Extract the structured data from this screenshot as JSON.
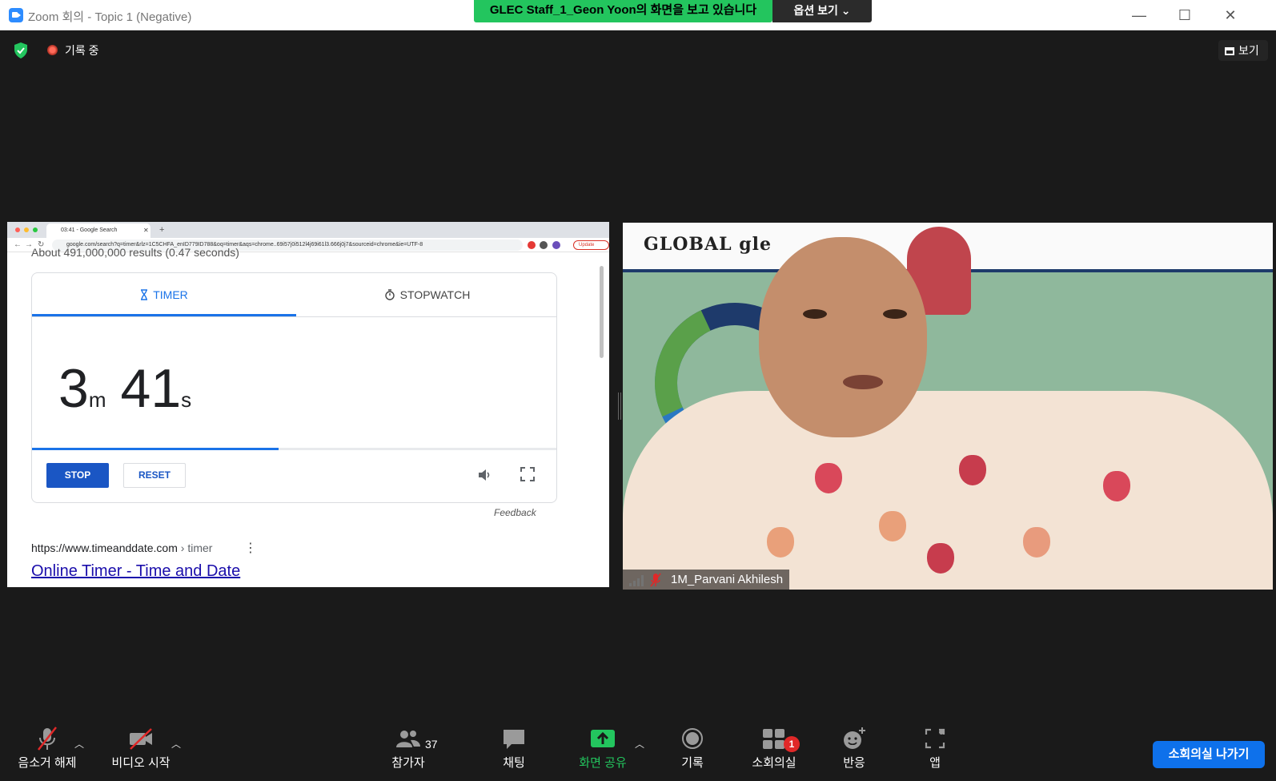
{
  "window": {
    "title": "Zoom 회의 - Topic 1 (Negative)",
    "controls": {
      "minimize": "—",
      "maximize": "☐",
      "close": "✕"
    }
  },
  "share_banner": {
    "text": "GLEC Staff_1_Geon Yoon의 화면을 보고 있습니다",
    "view_options": "옵션 보기 ⌄"
  },
  "meeting": {
    "recording_label": "기록 중",
    "view_button": "보기"
  },
  "shared_screen": {
    "browser_tab_title": "03:41 - Google Search",
    "address": "google.com/search?q=timer&rlz=1C5CHFA_enID779ID788&oq=timer&aqs=chrome..69i57j0i512l4j69i61l3.666j0j7&sourceid=chrome&ie=UTF-8",
    "update_label": "Update",
    "results_partial": "About 491,000,000 results (0.47 seconds)",
    "timer_tab": "TIMER",
    "stopwatch_tab": "STOPWATCH",
    "time_minutes": "3",
    "minutes_unit": "m",
    "time_seconds": "41",
    "seconds_unit": "s",
    "progress_fraction": 0.47,
    "stop_label": "STOP",
    "reset_label": "RESET",
    "feedback": "Feedback",
    "result_url_host": "https://www.timeanddate.com",
    "result_url_path": " › timer",
    "result_title": "Online Timer - Time and Date"
  },
  "video_tile": {
    "wall_logo": "GLOBAL gle",
    "participant_name": "1M_Parvani Akhilesh"
  },
  "toolbar": {
    "unmute_label": "음소거 해제",
    "start_video_label": "비디오 시작",
    "participants_label": "참가자",
    "participants_count": "37",
    "chat_label": "채팅",
    "share_label": "화면 공유",
    "record_label": "기록",
    "breakout_label": "소회의실",
    "breakout_badge": "1",
    "reactions_label": "반응",
    "apps_label": "앱",
    "leave_breakout_label": "소회의실 나가기"
  },
  "colors": {
    "share_banner_bg": "#23c55e",
    "share_icon": "#23c55e",
    "leave_button": "#0e71eb",
    "timer_accent": "#1a73e8",
    "stop_button": "#1a56c4",
    "badge_red": "#e02828"
  },
  "icons": [
    "zoom-logo-icon",
    "security-shield-icon",
    "recording-dot-icon",
    "grid-view-icon",
    "hourglass-icon",
    "stopwatch-icon",
    "sound-icon",
    "fullscreen-icon",
    "more-vertical-icon",
    "signal-icon",
    "mic-muted-icon",
    "video-muted-icon",
    "participants-icon",
    "chat-icon",
    "share-screen-icon",
    "record-icon",
    "breakout-rooms-icon",
    "reactions-icon",
    "apps-icon"
  ]
}
